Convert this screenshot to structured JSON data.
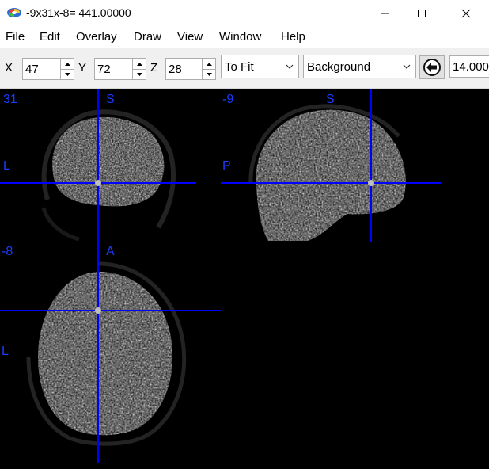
{
  "window": {
    "title": "-9x31x-8= 441.00000"
  },
  "menu": {
    "items": [
      "File",
      "Edit",
      "Overlay",
      "Draw",
      "View",
      "Window",
      "Help"
    ]
  },
  "toolbar": {
    "x_label": "X",
    "x_value": "47",
    "y_label": "Y",
    "y_value": "72",
    "z_label": "Z",
    "z_value": "28",
    "zoom_option": "To Fit",
    "layer_option": "Background",
    "threshold_value": "14.000"
  },
  "views": {
    "coronal": {
      "slice": "31",
      "top": "S",
      "left": "L"
    },
    "sagittal": {
      "slice": "-9",
      "top": "S",
      "left": "P"
    },
    "axial": {
      "slice": "-8",
      "top": "A",
      "left": "L"
    }
  },
  "colors": {
    "crosshair": "#0000ff",
    "label": "#1a3cff",
    "background": "#000000"
  }
}
